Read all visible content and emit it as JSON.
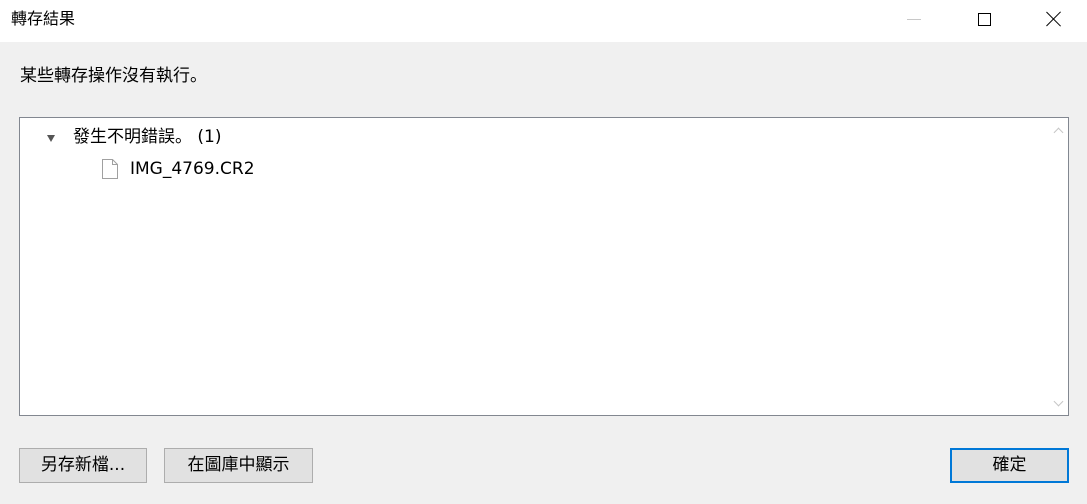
{
  "window": {
    "title": "轉存結果"
  },
  "message": "某些轉存操作沒有執行。",
  "tree": {
    "group_label": "發生不明錯誤。 (1)",
    "file_name": "IMG_4769.CR2"
  },
  "buttons": {
    "save_as": "另存新檔...",
    "show_in_library": "在圖庫中顯示",
    "ok": "確定"
  }
}
